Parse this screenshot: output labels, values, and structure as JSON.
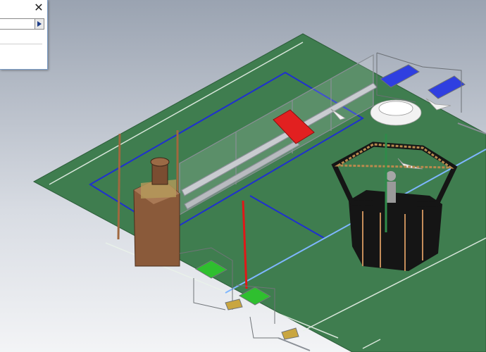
{
  "window": {
    "title": "",
    "close_glyph": "✕",
    "combo_value": ""
  },
  "icons": {
    "close": "close-icon",
    "dropdown": "chevron-right-icon"
  },
  "colors": {
    "background_top": "#9aa3b1",
    "background_bottom": "#f3f4f6",
    "floor_green": "#3f7d4f",
    "boundary_blue": "#1f2fd0",
    "laser_red": "#e01818",
    "laser_light_blue": "#7fb6ff",
    "machine_brown": "#8a5a3a",
    "bed_blue": "#2f3fe0",
    "bed_red": "#e22020",
    "tray_green": "#2fbf2f",
    "fan_white": "#f2f2f2",
    "cabin_black": "#151515"
  }
}
